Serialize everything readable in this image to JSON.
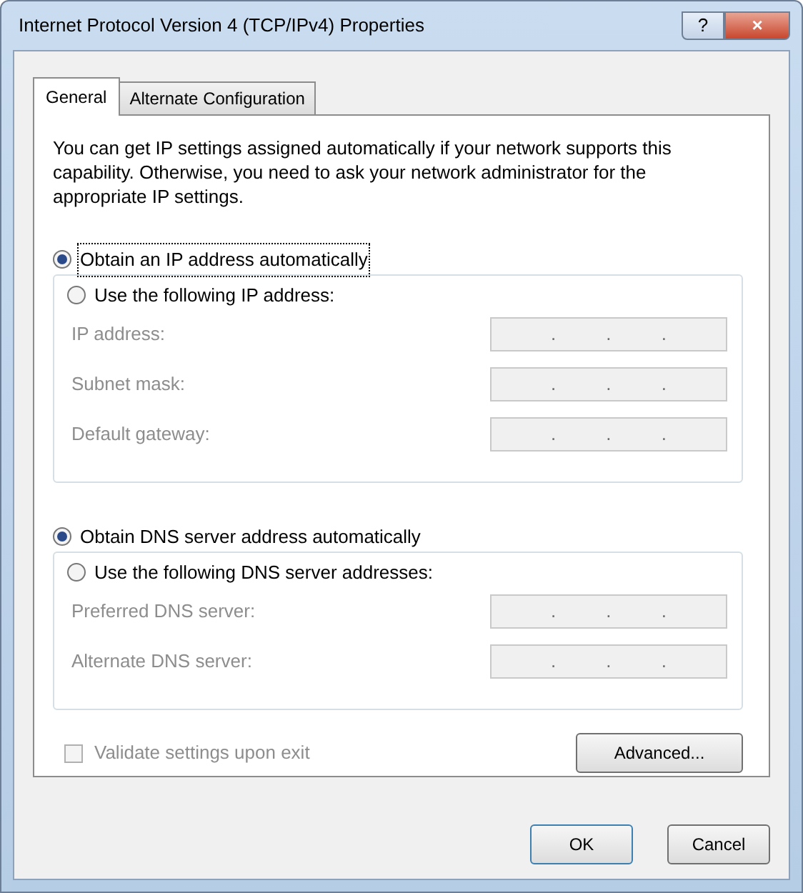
{
  "window": {
    "title": "Internet Protocol Version 4 (TCP/IPv4) Properties",
    "help": "?",
    "close": "×"
  },
  "tabs": [
    {
      "label": "General",
      "selected": true
    },
    {
      "label": "Alternate Configuration",
      "selected": false
    }
  ],
  "description": "You can get IP settings assigned automatically if your network supports this capability. Otherwise, you need to ask your network administrator for the appropriate IP settings.",
  "ip_choice": [
    {
      "label": "Obtain an IP address automatically",
      "selected": true
    },
    {
      "label": "Use the following IP address:",
      "selected": false
    }
  ],
  "ip_fields": [
    {
      "label": "IP address:",
      "disabled": true,
      "separators": [
        ".",
        ".",
        "."
      ]
    },
    {
      "label": "Subnet mask:",
      "disabled": true,
      "separators": [
        ".",
        ".",
        "."
      ]
    },
    {
      "label": "Default gateway:",
      "disabled": true,
      "separators": [
        ".",
        ".",
        "."
      ]
    }
  ],
  "dns_choice": [
    {
      "label": "Obtain DNS server address automatically",
      "selected": true
    },
    {
      "label": "Use the following DNS server addresses:",
      "selected": false
    }
  ],
  "dns_fields": [
    {
      "label": "Preferred DNS server:",
      "disabled": true,
      "separators": [
        ".",
        ".",
        "."
      ]
    },
    {
      "label": "Alternate DNS server:",
      "disabled": true,
      "separators": [
        ".",
        ".",
        "."
      ]
    }
  ],
  "validate": {
    "label": "Validate settings upon exit",
    "checked": false,
    "disabled": true
  },
  "advanced_button": "Advanced...",
  "buttons": [
    "OK",
    "Cancel"
  ]
}
